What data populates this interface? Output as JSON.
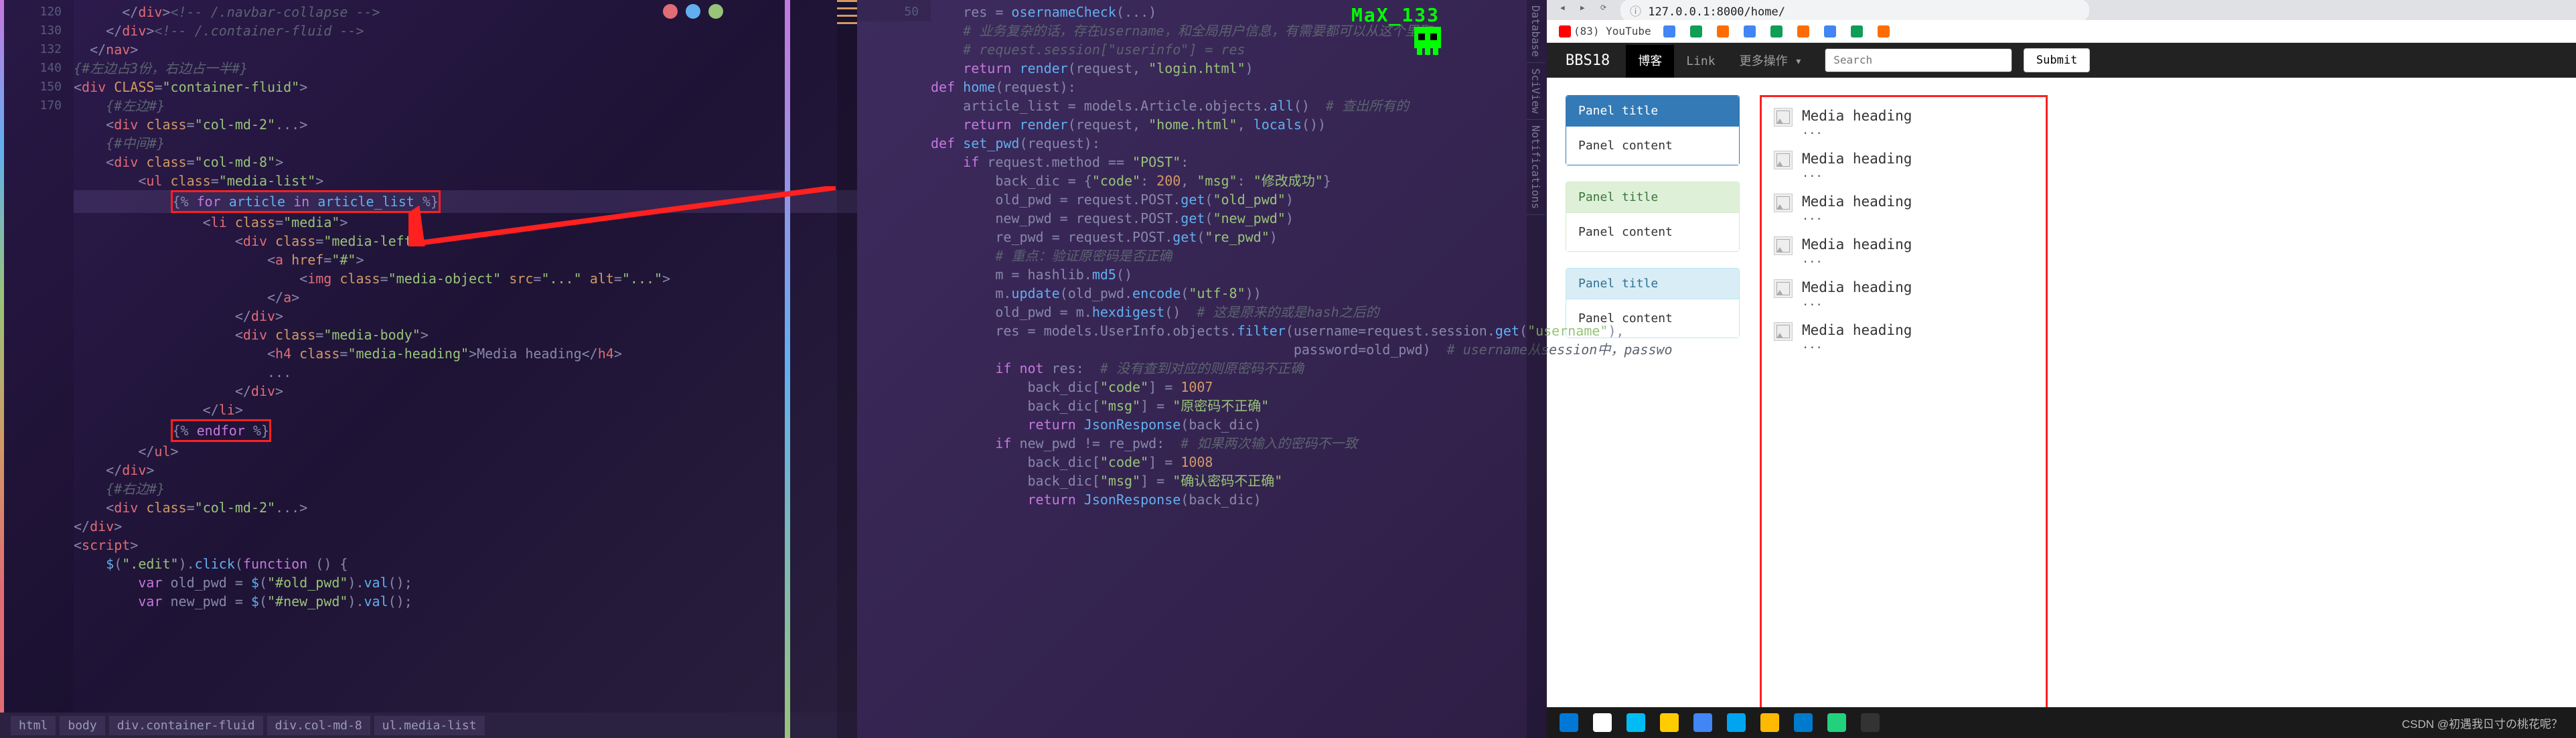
{
  "overlay": {
    "text": "MaX_133"
  },
  "left_editor": {
    "gutter_start": 116,
    "gutter": [
      "",
      "",
      "",
      "",
      "",
      "120",
      "",
      "",
      "",
      "",
      "",
      "",
      "",
      "",
      "",
      "130",
      "",
      "132",
      "",
      "",
      "",
      "",
      "",
      "",
      "",
      "140",
      "",
      "",
      "",
      "",
      "",
      "",
      "",
      "",
      "",
      "150",
      "",
      "",
      "",
      "",
      "",
      "",
      "",
      "",
      "",
      "",
      "",
      "",
      "",
      "",
      "",
      "",
      "",
      "",
      "",
      "",
      "",
      "",
      "",
      "170"
    ],
    "lines": [
      {
        "i": 0,
        "html": "      &lt;/<span class='tag'>div</span>&gt;<span class='cm'>&lt;!-- /.navbar-collapse --&gt;</span>"
      },
      {
        "i": 1,
        "html": "    &lt;/<span class='tag'>div</span>&gt;<span class='cm'>&lt;!-- /.container-fluid --&gt;</span>"
      },
      {
        "i": 2,
        "html": "  &lt;/<span class='tag'>nav</span>&gt;"
      },
      {
        "i": 3,
        "html": ""
      },
      {
        "i": 4,
        "html": "<span class='cm'>{#左边占3份，右边占一半#}</span>"
      },
      {
        "i": 5,
        "html": ""
      },
      {
        "i": 6,
        "html": "&lt;<span class='tag'>div</span> <span class='attr'>CLASS</span>=<span class='str'>\"container-fluid\"</span>&gt;"
      },
      {
        "i": 7,
        "html": "    <span class='cm'>{#左边#}</span>"
      },
      {
        "i": 8,
        "html": "    &lt;<span class='tag'>div</span> <span class='attr'>class</span>=<span class='str'>\"col-md-2\"</span>...&gt;"
      },
      {
        "i": 9,
        "html": "    <span class='cm'>{#中间#}</span>"
      },
      {
        "i": 10,
        "html": "    &lt;<span class='tag'>div</span> <span class='attr'>class</span>=<span class='str'>\"col-md-8\"</span>&gt;"
      },
      {
        "i": 11,
        "html": "        &lt;<span class='tag'>ul</span> <span class='attr'>class</span>=<span class='str'>\"media-list\"</span>&gt;"
      },
      {
        "i": 12,
        "html": "            <span class='red-box'>{% <span class='kw'>for</span> <span class='fn'>article</span> <span class='kw'>in</span> <span class='fn'>article_list</span> %}</span>",
        "hl": true
      },
      {
        "i": 13,
        "html": "                &lt;<span class='tag'>li</span> <span class='attr'>class</span>=<span class='str'>\"media\"</span>&gt;"
      },
      {
        "i": 14,
        "html": "                    &lt;<span class='tag'>div</span> <span class='attr'>class</span>=<span class='str'>\"media-left\"</span>&gt;"
      },
      {
        "i": 15,
        "html": "                        &lt;<span class='tag'>a</span> <span class='attr'>href</span>=<span class='str'>\"#\"</span>&gt;"
      },
      {
        "i": 16,
        "html": "                            &lt;<span class='tag'>img</span> <span class='attr'>class</span>=<span class='str'>\"media-object\"</span> <span class='attr'>src</span>=<span class='str'>\"...\"</span> <span class='attr'>alt</span>=<span class='str'>\"...\"</span>&gt;"
      },
      {
        "i": 17,
        "html": "                        &lt;/<span class='tag'>a</span>&gt;"
      },
      {
        "i": 18,
        "html": "                    &lt;/<span class='tag'>div</span>&gt;"
      },
      {
        "i": 19,
        "html": "                    &lt;<span class='tag'>div</span> <span class='attr'>class</span>=<span class='str'>\"media-body\"</span>&gt;"
      },
      {
        "i": 20,
        "html": "                        &lt;<span class='tag'>h4</span> <span class='attr'>class</span>=<span class='str'>\"media-heading\"</span>&gt;Media heading&lt;/<span class='tag'>h4</span>&gt;"
      },
      {
        "i": 21,
        "html": "                        ..."
      },
      {
        "i": 22,
        "html": "                    &lt;/<span class='tag'>div</span>&gt;"
      },
      {
        "i": 23,
        "html": "                &lt;/<span class='tag'>li</span>&gt;"
      },
      {
        "i": 24,
        "html": "            <span class='red-box'>{% <span class='kw'>endfor</span> %}</span>"
      },
      {
        "i": 25,
        "html": "        &lt;/<span class='tag'>ul</span>&gt;"
      },
      {
        "i": 26,
        "html": "    &lt;/<span class='tag'>div</span>&gt;"
      },
      {
        "i": 27,
        "html": "    <span class='cm'>{#右边#}</span>"
      },
      {
        "i": 28,
        "html": "    &lt;<span class='tag'>div</span> <span class='attr'>class</span>=<span class='str'>\"col-md-2\"</span>...&gt;"
      },
      {
        "i": 29,
        "html": "&lt;/<span class='tag'>div</span>&gt;"
      },
      {
        "i": 30,
        "html": ""
      },
      {
        "i": 31,
        "html": "&lt;<span class='tag'>script</span>&gt;"
      },
      {
        "i": 32,
        "html": "    <span class='fn'>$</span>(<span class='str'>\".edit\"</span>).<span class='fn'>click</span>(<span class='kw'>function</span> () {"
      },
      {
        "i": 33,
        "html": "        <span class='kw'>var</span> old_pwd = <span class='fn'>$</span>(<span class='str'>\"#old_pwd\"</span>).<span class='fn'>val</span>();"
      },
      {
        "i": 34,
        "html": "        <span class='kw'>var</span> new_pwd = <span class='fn'>$</span>(<span class='str'>\"#new_pwd\"</span>).<span class='fn'>val</span>();"
      }
    ],
    "breadcrumbs": [
      "html",
      "body",
      "div.container-fluid",
      "div.col-md-8",
      "ul.media-list"
    ]
  },
  "right_editor": {
    "gutter": [
      "",
      "",
      "",
      "",
      "",
      "",
      "",
      "50",
      "",
      "",
      "",
      "",
      "",
      "",
      "",
      "",
      "",
      "",
      "",
      "",
      "",
      "",
      "",
      "",
      "",
      "",
      "",
      "",
      "",
      "",
      "",
      "",
      "",
      "",
      "",
      "",
      "",
      "",
      "",
      "",
      "",
      "",
      "",
      "",
      "",
      "",
      "",
      "",
      "",
      "",
      ""
    ],
    "lines": [
      {
        "html": "    res = <span class='fn'>osernameCheck</span>(...)"
      },
      {
        "html": "<span class='cm'>    # 业务复杂的话，存在username，和全局用户信息，有需要都可以从这个里取</span>"
      },
      {
        "html": "<span class='cm'>    # request.session[\"userinfo\"] = res</span>"
      },
      {
        "html": ""
      },
      {
        "html": "    <span class='kw'>return</span> <span class='fn'>render</span>(request, <span class='str'>\"login.html\"</span>)"
      },
      {
        "html": ""
      },
      {
        "html": ""
      },
      {
        "html": "<span class='kw'>def</span> <span class='fn'>home</span>(request):"
      },
      {
        "html": "    article_list = models.Article.objects.<span class='fn'>all</span>()  <span class='cm'># 查出所有的</span>"
      },
      {
        "html": "    <span class='kw'>return</span> <span class='fn'>render</span>(request, <span class='str'>\"home.html\"</span>, <span class='fn'>locals</span>())"
      },
      {
        "html": ""
      },
      {
        "html": ""
      },
      {
        "html": "<span class='kw'>def</span> <span class='fn'>set_pwd</span>(request):"
      },
      {
        "html": "    <span class='kw'>if</span> request.method == <span class='str'>\"POST\"</span>:"
      },
      {
        "html": "        back_dic = {<span class='str'>\"code\"</span>: <span class='num'>200</span>, <span class='str'>\"msg\"</span>: <span class='str'>\"修改成功\"</span>}"
      },
      {
        "html": "        old_pwd = request.POST.<span class='fn'>get</span>(<span class='str'>\"old_pwd\"</span>)"
      },
      {
        "html": "        new_pwd = request.POST.<span class='fn'>get</span>(<span class='str'>\"new_pwd\"</span>)"
      },
      {
        "html": "        re_pwd = request.POST.<span class='fn'>get</span>(<span class='str'>\"re_pwd\"</span>)"
      },
      {
        "html": "        <span class='cm'># 重点：验证原密码是否正确</span>"
      },
      {
        "html": "        m = hashlib.<span class='fn'>md5</span>()"
      },
      {
        "html": "        m.<span class='fn'>update</span>(old_pwd.<span class='fn'>encode</span>(<span class='str'>\"utf-8\"</span>))"
      },
      {
        "html": "        old_pwd = m.<span class='fn'>hexdigest</span>()  <span class='cm'># 这是原来的或是hash之后的</span>"
      },
      {
        "html": "        res = models.UserInfo.objects.<span class='fn'>filter</span>(username=request.session.<span class='fn'>get</span>(<span class='str'>\"username\"</span>),"
      },
      {
        "html": "                                             password=old_pwd)  <span class='cm'># username从session中，passwo</span>"
      },
      {
        "html": "        <span class='kw'>if not</span> res:  <span class='cm'># 没有查到对应的则原密码不正确</span>"
      },
      {
        "html": "            back_dic[<span class='str'>\"code\"</span>] = <span class='num'>1007</span>"
      },
      {
        "html": "            back_dic[<span class='str'>\"msg\"</span>] = <span class='str'>\"原密码不正确\"</span>"
      },
      {
        "html": "            <span class='kw'>return</span> <span class='fn'>JsonResponse</span>(back_dic)"
      },
      {
        "html": ""
      },
      {
        "html": "        <span class='kw'>if</span> new_pwd != re_pwd:  <span class='cm'># 如果两次输入的密码不一致</span>"
      },
      {
        "html": "            back_dic[<span class='str'>\"code\"</span>] = <span class='num'>1008</span>"
      },
      {
        "html": "            back_dic[<span class='str'>\"msg\"</span>] = <span class='str'>\"确认密码不正确\"</span>"
      },
      {
        "html": "            <span class='kw'>return</span> <span class='fn'>JsonResponse</span>(back_dic)"
      }
    ]
  },
  "right_tabs": [
    "Database",
    "SciView",
    "Notifications"
  ],
  "browser": {
    "address": "127.0.0.1:8000/home/",
    "bookmarks": [
      {
        "label": "(83) YouTube",
        "cls": "y"
      },
      {
        "label": "",
        "cls": "b"
      },
      {
        "label": "",
        "cls": "g"
      },
      {
        "label": "",
        "cls": "o"
      },
      {
        "label": "",
        "cls": "b"
      },
      {
        "label": "",
        "cls": "g"
      },
      {
        "label": "",
        "cls": "o"
      },
      {
        "label": "",
        "cls": "b"
      },
      {
        "label": "",
        "cls": "g"
      },
      {
        "label": "",
        "cls": "o"
      }
    ],
    "nav": {
      "brand": "BBS18",
      "links": [
        {
          "label": "博客",
          "active": true
        },
        {
          "label": "Link",
          "active": false
        },
        {
          "label": "更多操作 ▾",
          "active": false
        }
      ],
      "search_placeholder": "Search",
      "submit": "Submit"
    },
    "panels": [
      {
        "type": "primary",
        "title": "Panel title",
        "content": "Panel content"
      },
      {
        "type": "success",
        "title": "Panel title",
        "content": "Panel content"
      },
      {
        "type": "info",
        "title": "Panel title",
        "content": "Panel content"
      }
    ],
    "media": [
      {
        "heading": "Media heading",
        "text": "..."
      },
      {
        "heading": "Media heading",
        "text": "..."
      },
      {
        "heading": "Media heading",
        "text": "..."
      },
      {
        "heading": "Media heading",
        "text": "..."
      },
      {
        "heading": "Media heading",
        "text": "..."
      },
      {
        "heading": "Media heading",
        "text": "..."
      }
    ]
  },
  "taskbar_icons": [
    "windows",
    "search",
    "cortana",
    "chrome",
    "edge",
    "weather",
    "folder",
    "vscode",
    "pycharm",
    "terminal"
  ],
  "csdn_watermark": "CSDN @初遇我ㄖ寸の桃花呢？"
}
